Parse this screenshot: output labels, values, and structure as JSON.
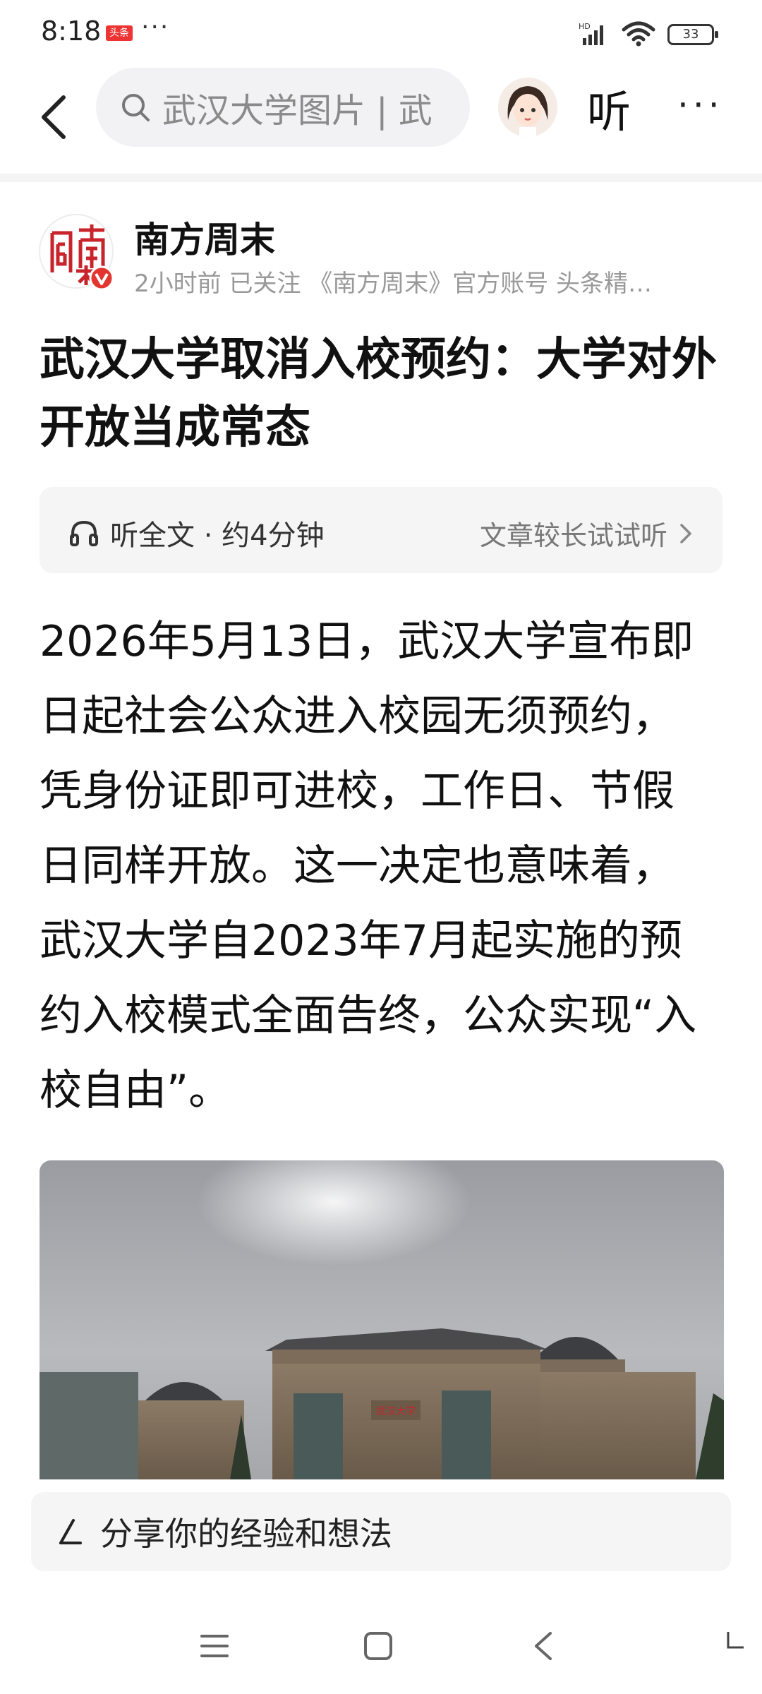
{
  "status_bar": {
    "time": "8:18",
    "app_badge": "头条",
    "more": "···",
    "battery": "33",
    "network": "HD"
  },
  "nav": {
    "search_placeholder": "武汉大学图片 | 武",
    "listen_label": "听",
    "more_label": "···"
  },
  "author": {
    "name": "南方周末",
    "meta": "2小时前  已关注  《南方周末》官方账号 头条精…"
  },
  "article": {
    "title": "武汉大学取消入校预约：大学对外开放当成常态",
    "listen_left": "听全文 · 约4分钟",
    "listen_right": "文章较长试试听",
    "paragraph": "2026年5月13日，武汉大学宣布即日起社会公众进入校园无须预约，凭身份证即可进校，工作日、节假日同样开放。这一决定也意味着，武汉大学自2023年7月起实施的预约入校模式全面告终，公众实现“入校自由”。",
    "image_sign": "武汉大学"
  },
  "comment": {
    "placeholder": "分享你的经验和想法"
  },
  "colors": {
    "accent_red": "#c8242c",
    "muted_text": "#999999",
    "panel_bg": "#f5f5f6"
  }
}
